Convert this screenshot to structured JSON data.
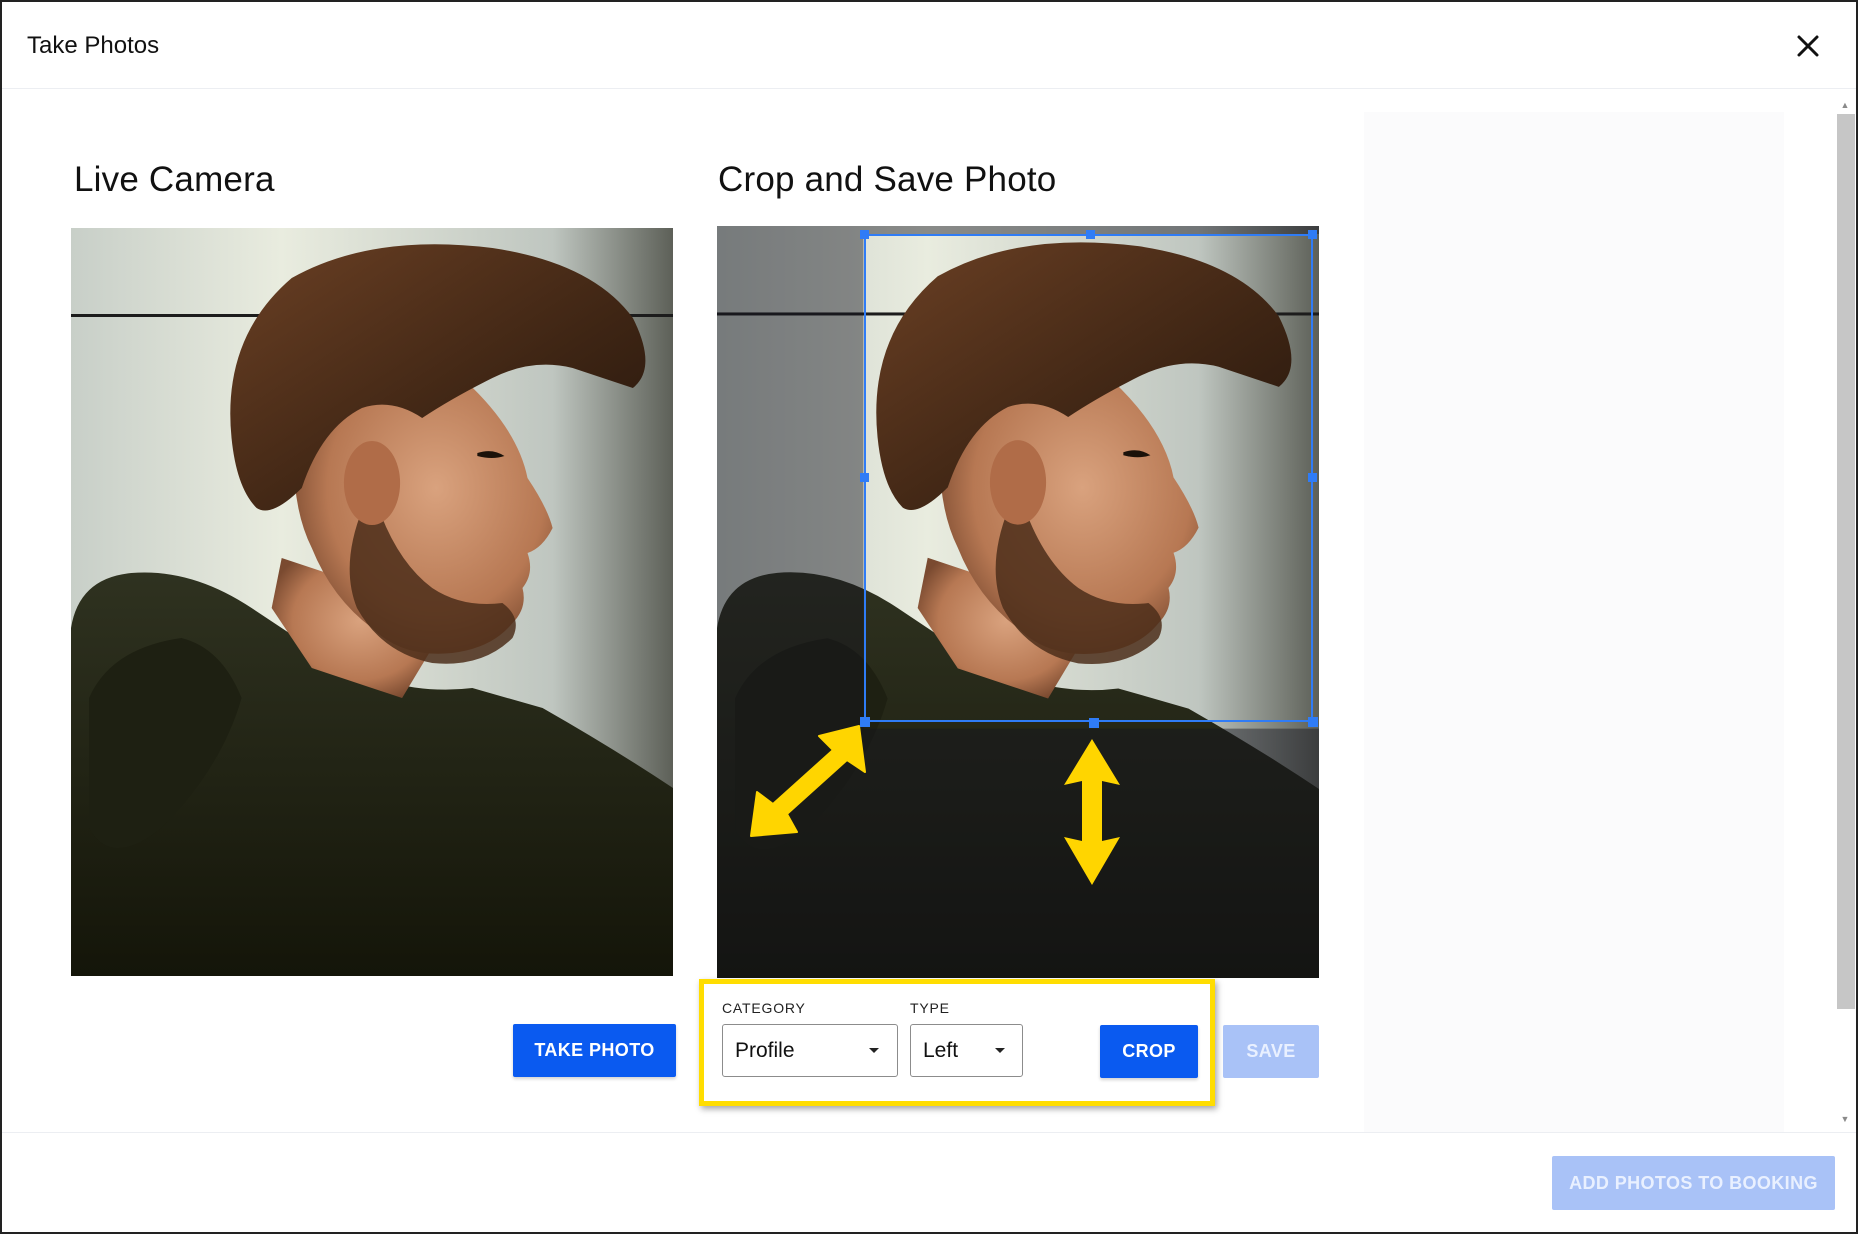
{
  "dialog": {
    "title": "Take Photos"
  },
  "live_camera": {
    "title": "Live Camera",
    "take_photo_label": "TAKE PHOTO"
  },
  "crop_panel": {
    "title": "Crop and Save Photo",
    "crop_label": "CROP",
    "save_label": "SAVE",
    "category": {
      "label": "CATEGORY",
      "value": "Profile"
    },
    "type": {
      "label": "TYPE",
      "value": "Left"
    }
  },
  "footer": {
    "add_photos_label": "ADD PHOTOS TO BOOKING"
  },
  "colors": {
    "primary": "#0a5af0",
    "primary_disabled": "#a9c2f7",
    "highlight": "#ffdd00",
    "crop_frame": "#2f7cf6",
    "annotation_arrow": "#ffd500"
  },
  "icons": [
    "close-icon",
    "chevron-down-icon",
    "resize-diagonal-arrow",
    "resize-vertical-arrow"
  ]
}
